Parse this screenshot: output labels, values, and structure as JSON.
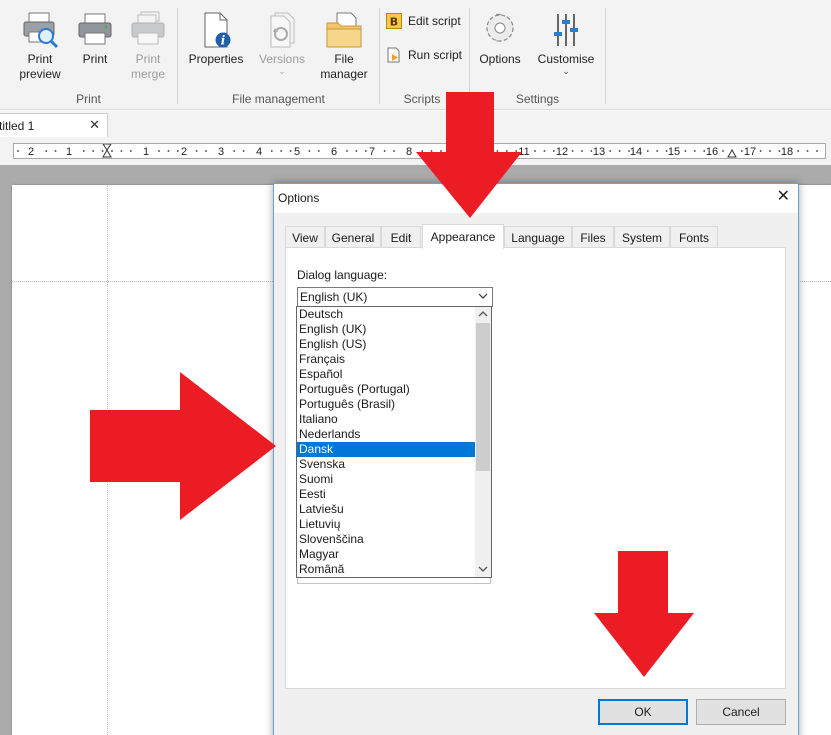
{
  "ribbon": {
    "groups": {
      "print": "Print",
      "file_management": "File management",
      "scripts": "Scripts",
      "settings": "Settings"
    },
    "buttons": {
      "print_preview": [
        "Print",
        "preview"
      ],
      "print": "Print",
      "print_merge": [
        "Print",
        "merge"
      ],
      "properties": "Properties",
      "versions": "Versions",
      "file_manager": [
        "File",
        "manager"
      ],
      "edit_script": "Edit script",
      "run_script": "Run script",
      "options": "Options",
      "customise": "Customise"
    }
  },
  "document_tab": {
    "label": "titled 1"
  },
  "ruler": {
    "labels": [
      "2",
      "1",
      "1",
      "2",
      "3",
      "4",
      "5",
      "6",
      "7",
      "8",
      "11",
      "12",
      "13",
      "14",
      "15",
      "16",
      "17",
      "18"
    ]
  },
  "dialog": {
    "title": "Options",
    "tabs": [
      "View",
      "General",
      "Edit",
      "Appearance",
      "Language",
      "Files",
      "System",
      "Fonts"
    ],
    "active_tab": "Appearance",
    "language_label": "Dialog language:",
    "language_value": "English (UK)",
    "languages": [
      "Deutsch",
      "English (UK)",
      "English (US)",
      "Français",
      "Español",
      "Português (Portugal)",
      "Português (Brasil)",
      "Italiano",
      "Nederlands",
      "Dansk",
      "Svenska",
      "Suomi",
      "Eesti",
      "Latviešu",
      "Lietuvių",
      "Slovenščina",
      "Magyar",
      "Română"
    ],
    "highlighted_language": "Dansk",
    "ok_label": "OK",
    "cancel_label": "Cancel"
  },
  "colors": {
    "annotation_red": "#ec1c24",
    "selection_blue": "#0078d7",
    "dialog_border": "#6f9fd8"
  }
}
